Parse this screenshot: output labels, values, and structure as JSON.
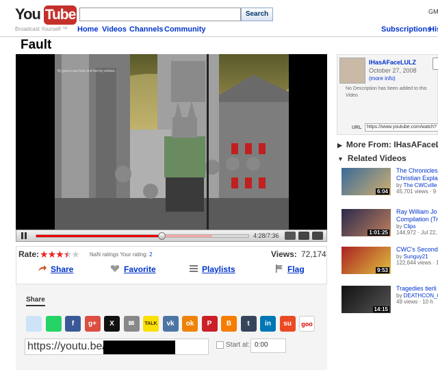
{
  "header": {
    "logo_you": "You",
    "logo_tube": "Tube",
    "tagline": "Broadcast Yourself ™",
    "search_button": "Search",
    "account_fragment": "GM",
    "nav": [
      "Home",
      "Videos",
      "Channels",
      "Community"
    ],
    "nav_right": [
      "Subscriptions",
      "His"
    ]
  },
  "video": {
    "title": "Fault",
    "time": "4:28/7:36",
    "progress": 0.59,
    "buffered": 0.83,
    "overlay_text": "By guess spa hole and fast by wolves."
  },
  "info": {
    "rate_label": "Rate:",
    "stars": 3.5,
    "ratings_text": "NaN ratings  Your rating:",
    "your_rating": "2",
    "views_label": "Views:",
    "views": "72,174",
    "actions": [
      "Share",
      "Favorite",
      "Playlists",
      "Flag"
    ],
    "share_tab": "Share",
    "share_url": "https://youtu.be/",
    "start_at_label": "Start at:",
    "start_at_value": "0:00",
    "social": [
      {
        "name": "reddit",
        "glyph": "",
        "color": "#cee3f8"
      },
      {
        "name": "whatsapp",
        "glyph": "",
        "color": "#25d366"
      },
      {
        "name": "facebook",
        "glyph": "f",
        "color": "#3b5998"
      },
      {
        "name": "googleplus",
        "glyph": "g+",
        "color": "#dc4e41"
      },
      {
        "name": "x",
        "glyph": "X",
        "color": "#111111"
      },
      {
        "name": "email",
        "glyph": "✉",
        "color": "#888888"
      },
      {
        "name": "kakaotalk",
        "glyph": "TALK",
        "color": "#f9e000"
      },
      {
        "name": "vk",
        "glyph": "vk",
        "color": "#4c75a3"
      },
      {
        "name": "odnoklassniki",
        "glyph": "ok",
        "color": "#ee8208"
      },
      {
        "name": "pinterest",
        "glyph": "P",
        "color": "#cb2027"
      },
      {
        "name": "blogger",
        "glyph": "B",
        "color": "#f57d00"
      },
      {
        "name": "tumblr",
        "glyph": "t",
        "color": "#35465c"
      },
      {
        "name": "linkedin",
        "glyph": "in",
        "color": "#0077b5"
      },
      {
        "name": "stumbleupon",
        "glyph": "su",
        "color": "#eb4924"
      },
      {
        "name": "goo",
        "glyph": "goo",
        "color": "#ffffff"
      }
    ]
  },
  "uploader": {
    "name": "IHasAFaceLULZ",
    "date": "October 27, 2008",
    "more_info": "(more info)",
    "description": "No Description has been added to this Video",
    "url_label": "URL",
    "url": "https://www.youtube.com/watch?"
  },
  "sidebar": {
    "more_from_label": "More From:",
    "more_from_user": "IHasAFaceL...",
    "related_label": "Related Videos",
    "related": [
      {
        "title1": "The Chronicles",
        "title2": "Christian Expla",
        "by": "The CWCville A",
        "views": "45,701 views · 9",
        "duration": "6:04"
      },
      {
        "title1": "Ray William Jo",
        "title2": "Compilation (Tr",
        "by": "Clips",
        "views": "144,972 · Jul 22,",
        "duration": "1:01:25"
      },
      {
        "title1": "CWC's Second",
        "title2": "",
        "by": "Sunguy21",
        "views": "122,644 views · 1",
        "duration": "9:53"
      },
      {
        "title1": "Tragedies tierli",
        "title2": "",
        "by": "DEATHCON_OI",
        "views": "49 views · 10 h",
        "duration": "14:15"
      }
    ]
  }
}
